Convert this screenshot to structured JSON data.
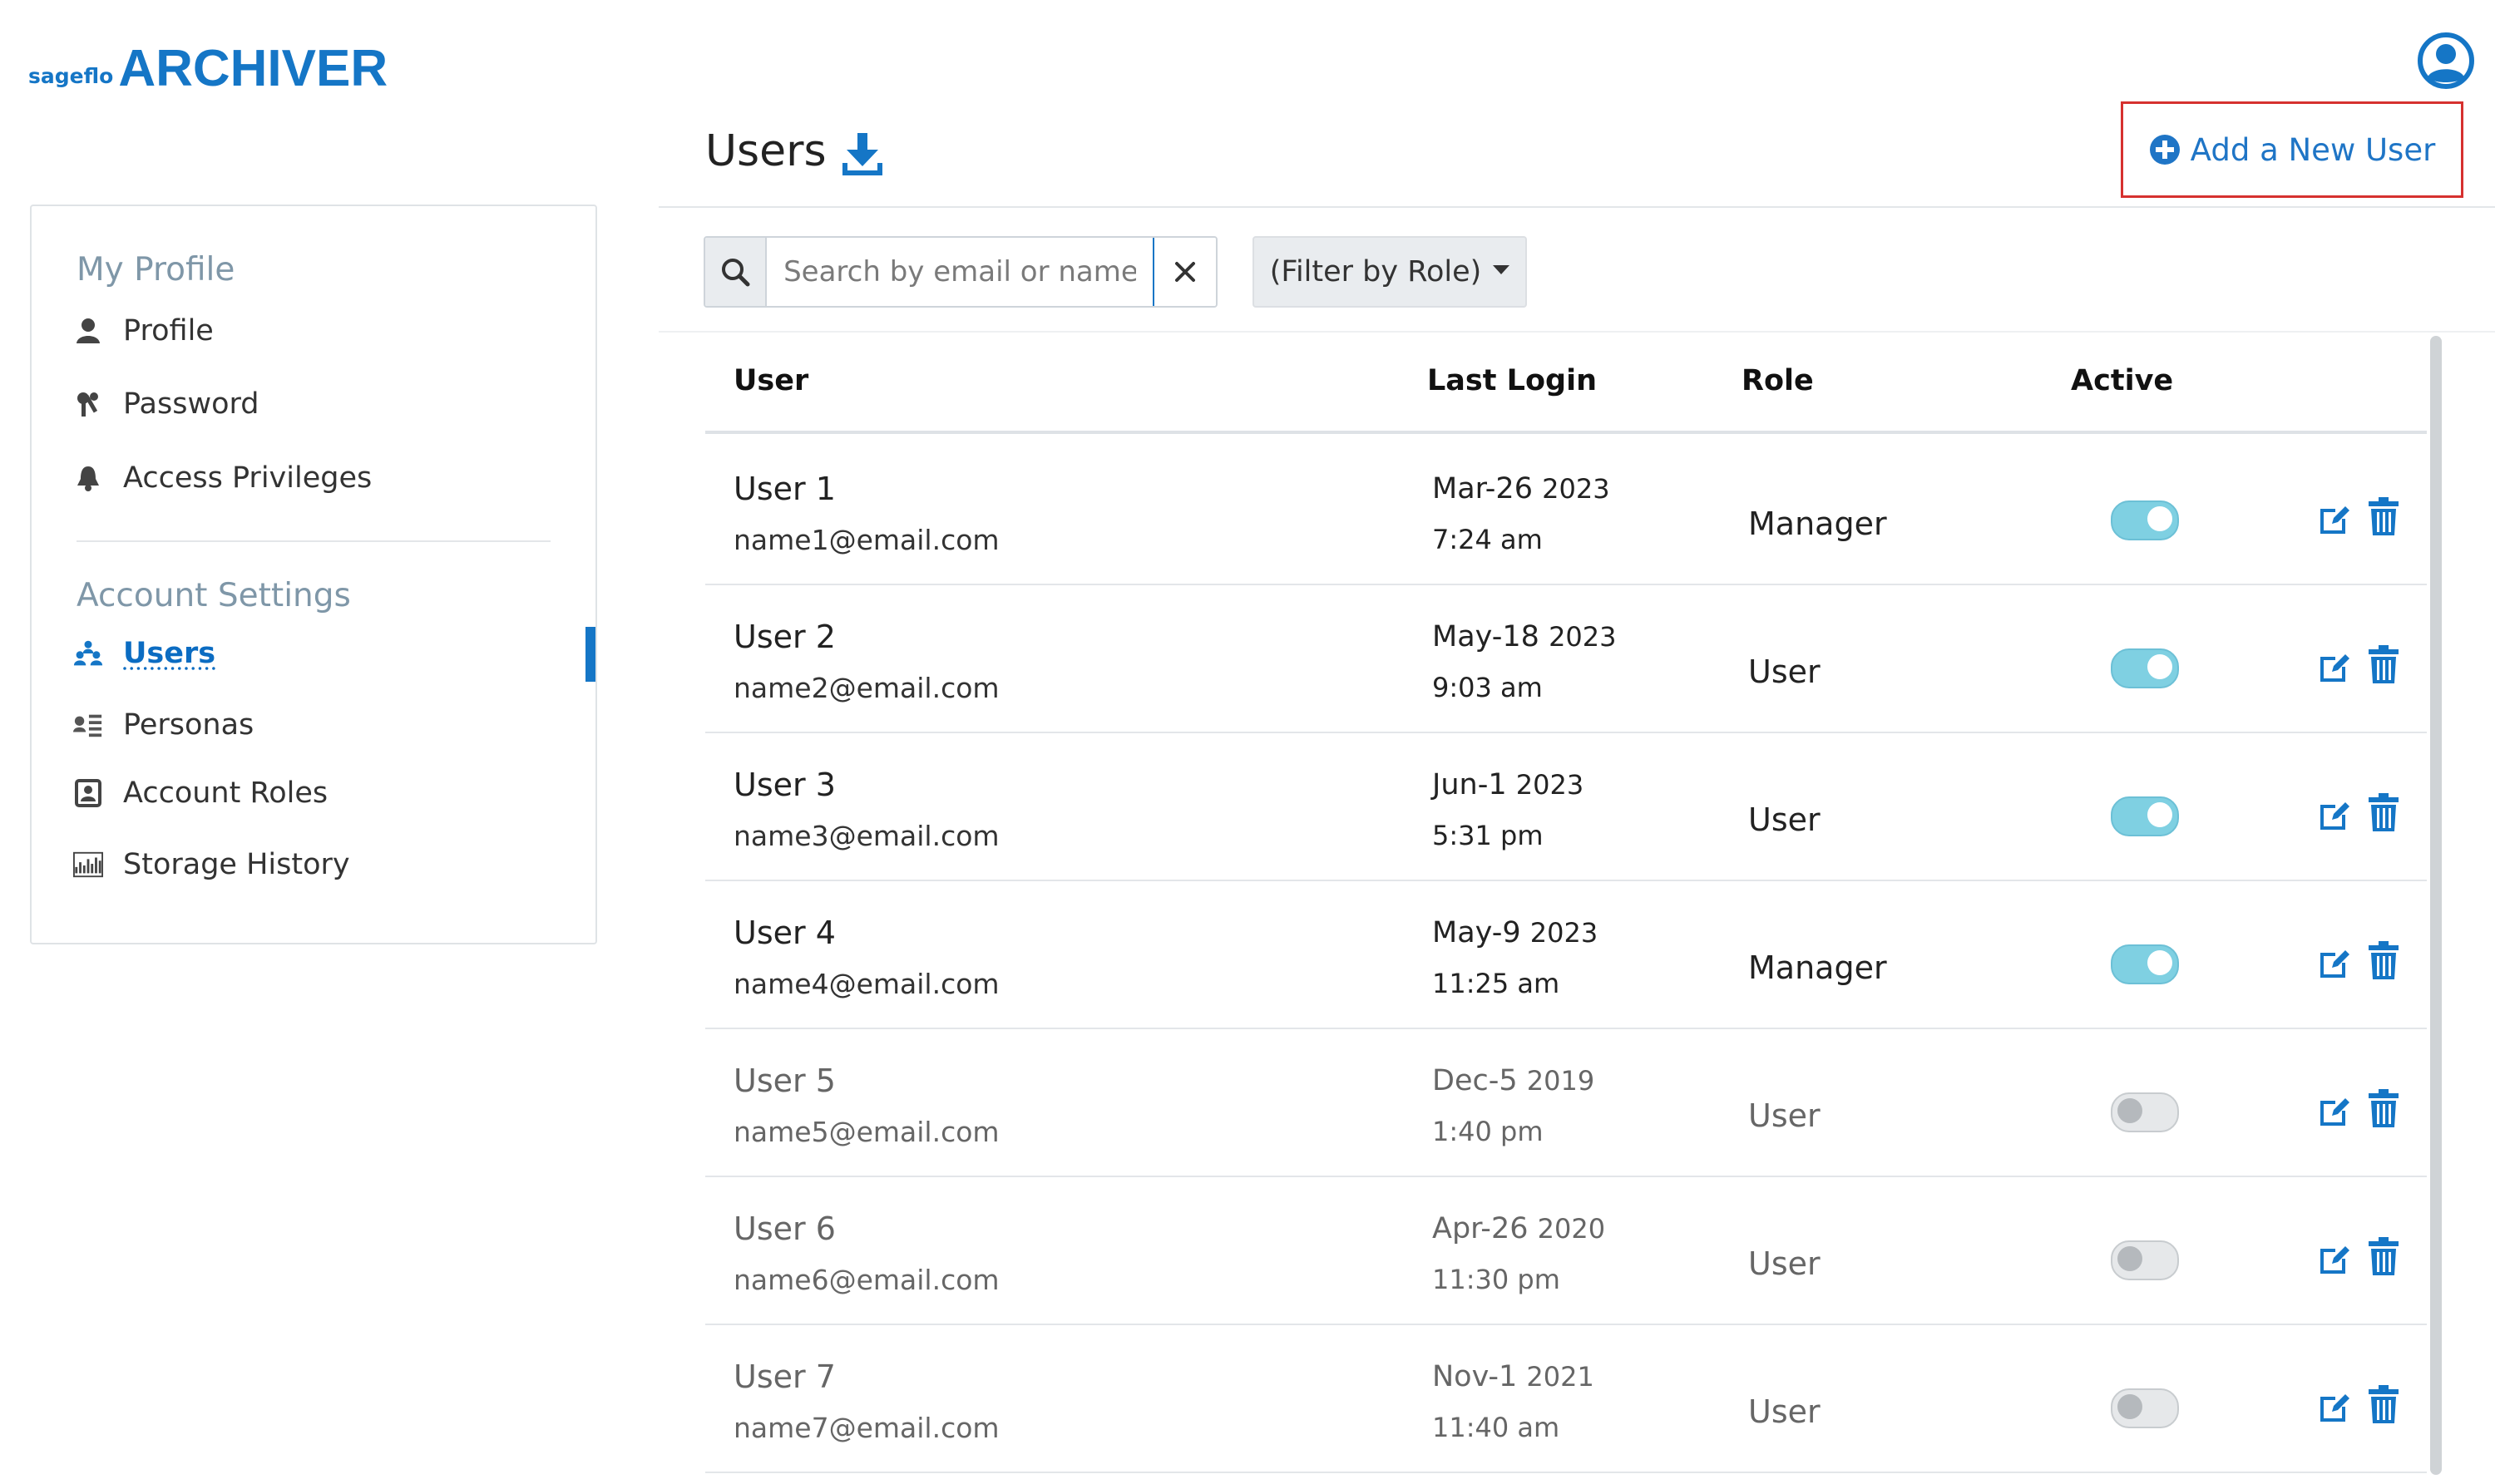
{
  "brand": {
    "small": "sageflo",
    "big": "ARCHIVER",
    "color": "#1576c6"
  },
  "header": {
    "avatar_icon": "user-circle-icon"
  },
  "sidebar": {
    "sections": [
      {
        "title": "My Profile",
        "items": [
          {
            "label": "Profile",
            "icon": "person-icon"
          },
          {
            "label": "Password",
            "icon": "key-icon"
          },
          {
            "label": "Access Privileges",
            "icon": "bell-icon"
          }
        ]
      },
      {
        "title": "Account Settings",
        "items": [
          {
            "label": "Users",
            "icon": "users-icon",
            "active": true
          },
          {
            "label": "Personas",
            "icon": "personas-icon"
          },
          {
            "label": "Account Roles",
            "icon": "roles-icon"
          },
          {
            "label": "Storage History",
            "icon": "chart-icon"
          }
        ]
      }
    ]
  },
  "page": {
    "title": "Users",
    "download_icon": "download-icon",
    "add_button_label": "Add a New User",
    "add_button_icon": "plus-circle-icon"
  },
  "toolbar": {
    "search_placeholder": "Search by email or name",
    "search_value": "",
    "filter_label": "(Filter by Role)"
  },
  "table": {
    "headers": [
      "User",
      "Last Login",
      "Role",
      "Active"
    ],
    "rows": [
      {
        "name": "User 1",
        "email": "name1@email.com",
        "date": "Mar-26",
        "year": "2023",
        "time": "7:24 am",
        "role": "Manager",
        "active": true
      },
      {
        "name": "User 2",
        "email": "name2@email.com",
        "date": "May-18",
        "year": "2023",
        "time": "9:03 am",
        "role": "User",
        "active": true
      },
      {
        "name": "User 3",
        "email": "name3@email.com",
        "date": "Jun-1",
        "year": "2023",
        "time": "5:31 pm",
        "role": "User",
        "active": true
      },
      {
        "name": "User 4",
        "email": "name4@email.com",
        "date": "May-9",
        "year": "2023",
        "time": "11:25 am",
        "role": "Manager",
        "active": true
      },
      {
        "name": "User 5",
        "email": "name5@email.com",
        "date": "Dec-5",
        "year": "2019",
        "time": "1:40 pm",
        "role": "User",
        "active": false
      },
      {
        "name": "User 6",
        "email": "name6@email.com",
        "date": "Apr-26",
        "year": "2020",
        "time": "11:30 pm",
        "role": "User",
        "active": false
      },
      {
        "name": "User 7",
        "email": "name7@email.com",
        "date": "Nov-1",
        "year": "2021",
        "time": "11:40 am",
        "role": "User",
        "active": false
      }
    ]
  },
  "colors": {
    "accent": "#1576c6",
    "toggle_on": "#7fd0e2",
    "highlight_border": "#d6312f"
  }
}
